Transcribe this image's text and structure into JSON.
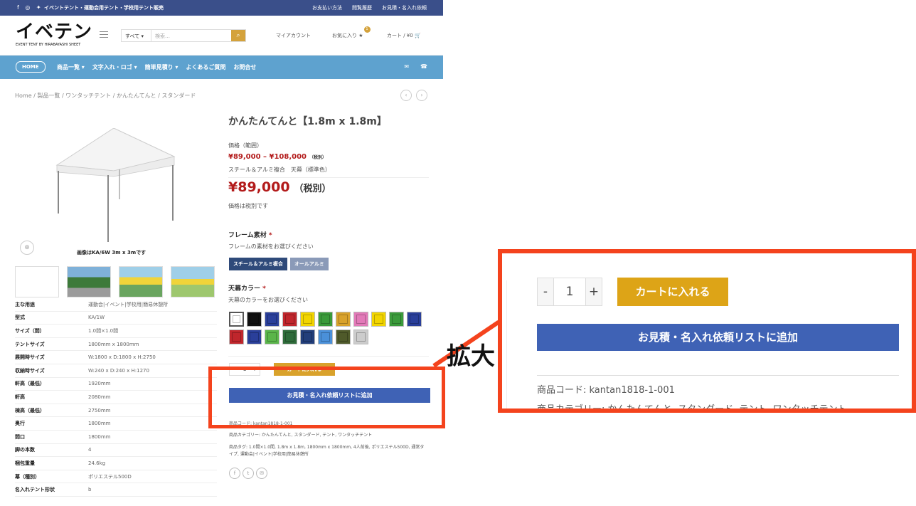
{
  "topbar": {
    "social": "f ◎ ✦",
    "tagline": "イベントテント・運動会用テント・学校用テント販売",
    "links": [
      "お支払い方法",
      "閲覧履歴",
      "お見積・名入れ依頼"
    ]
  },
  "header": {
    "logo": "イベテン",
    "logo_sub": "EVENT TENT BY HIRABAYASHI SHEET",
    "search_category": "すべて ▾",
    "search_placeholder": "検索…",
    "search_button": "⌕",
    "account": "マイアカウント",
    "favorites": "お気に入り ★",
    "favorites_count": "1",
    "cart": "カート / ¥0 🛒"
  },
  "nav": {
    "home": "HOME",
    "items": [
      "商品一覧 ▾",
      "文字入れ・ロゴ ▾",
      "簡単見積り ▾",
      "よくあるご質問",
      "お問合せ"
    ],
    "icons": [
      "✉",
      "☎"
    ]
  },
  "breadcrumb": "Home  /  製品一覧  /  ワンタッチテント  /  かんたんてんと  /  スタンダード",
  "pager": [
    "‹",
    "›"
  ],
  "product_image": {
    "caption": "画像はKA/6W 3m x 3mです",
    "zoom_icon": "⊕"
  },
  "spec_table": [
    {
      "k": "主な用途",
      "v": "運動会|イベント|学校用|簡易休憩所"
    },
    {
      "k": "型式",
      "v": "KA/1W"
    },
    {
      "k": "サイズ（間）",
      "v": "1.0間×1.0間"
    },
    {
      "k": "テントサイズ",
      "v": "1800mm x 1800mm"
    },
    {
      "k": "展開時サイズ",
      "v": "W:1800 x D:1800 x H:2750"
    },
    {
      "k": "収納時サイズ",
      "v": "W:240 x D:240 x H:1270"
    },
    {
      "k": "軒高（最低）",
      "v": "1920mm"
    },
    {
      "k": "軒高",
      "v": "2080mm"
    },
    {
      "k": "棟高（最低）",
      "v": "2750mm"
    },
    {
      "k": "奥行",
      "v": "1800mm"
    },
    {
      "k": "間口",
      "v": "1800mm"
    },
    {
      "k": "脚の本数",
      "v": "4"
    },
    {
      "k": "梱包重量",
      "v": "24.6kg"
    },
    {
      "k": "幕（種別）",
      "v": "ポリエステル500D"
    },
    {
      "k": "名入れテント形状",
      "v": "b"
    }
  ],
  "product": {
    "title": "かんたんてんと【1.8m x 1.8m】",
    "range_label": "価格（範囲）",
    "range": "¥89,000 – ¥108,000",
    "range_tax": "（税別）",
    "variant": "スチール＆アルミ複合　天幕（標準色）",
    "price": "¥89,000",
    "price_tax": "（税別）",
    "tax_note": "価格は税別です",
    "frame_label": "フレーム素材",
    "required": "*",
    "frame_sub": "フレームの素材をお選びください",
    "frame_options": [
      "スチール＆アルミ複合",
      "オールアルミ"
    ],
    "color_label": "天幕カラー",
    "color_sub": "天幕のカラーをお選びください",
    "swatches": [
      "#ffffff",
      "#111111",
      "#2a3f9a",
      "#c0262c",
      "#f2d500",
      "#3a9a3a",
      "#d9a22c",
      "#e27ab8",
      "#f2d500",
      "#3a9a3a",
      "#2a3f9a",
      "#c0262c",
      "#2a3f9a",
      "#5ab54a",
      "#2e6b3a",
      "#223e7a",
      "#4a90d9",
      "#4f5a2a",
      "#cccccc"
    ],
    "qty": "1",
    "qty_minus": "-",
    "qty_plus": "+",
    "add_to_cart": "カートに入れる",
    "add_quote": "お見積・名入れ依頼リストに追加",
    "sku_small": "商品コード: kantan1818-1-001",
    "categories": "商品カテゴリー: かんたんてんと, スタンダード, テント, ワンタッチテント",
    "tags": "商品タグ: 1.0間×1.0間, 1.8m x 1.8m, 1800mm x 1800mm, 4人前後, ポリエステル500D, 通常タイプ, 運動会|イベント|学校用|簡易休憩所",
    "share": [
      "f",
      "t",
      "✉"
    ]
  },
  "zoom": {
    "label": "拡大",
    "sku": "商品コード: kantan1818-1-001",
    "categories": "商品カテゴリー: かんたんてんと, スタンダード, テント, ワンタッチテント"
  },
  "colors": {
    "accent": "#f4431d",
    "nav": "#5ea2cf",
    "topbar": "#3a4f8a",
    "price": "#b31b1b",
    "cart": "#d9a22c",
    "quote": "#3f62b5"
  }
}
